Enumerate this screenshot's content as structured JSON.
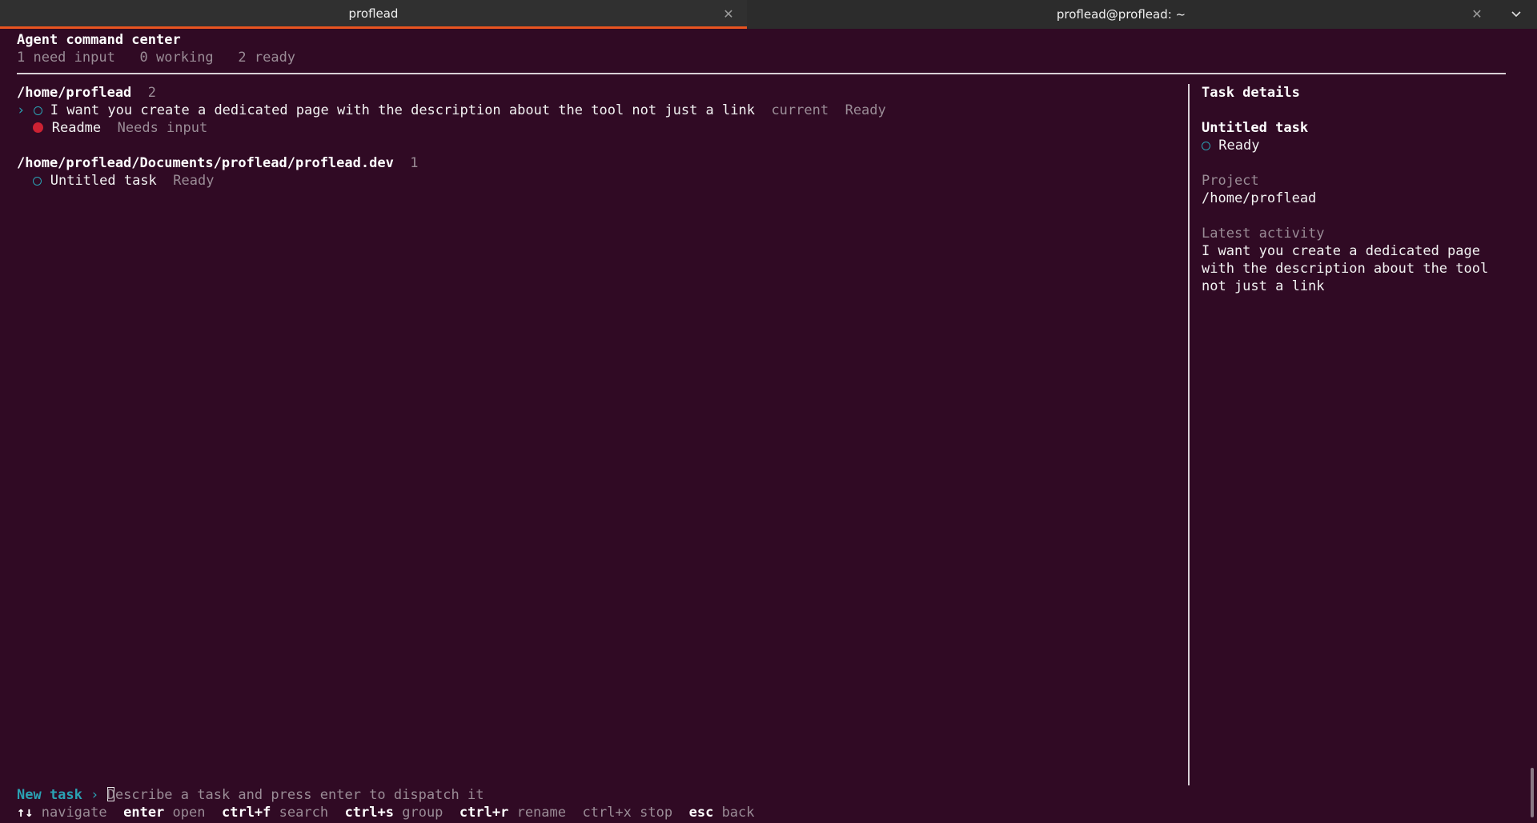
{
  "tabs": [
    {
      "title": "proflead",
      "active": true
    },
    {
      "title": "proflead@proflead: ~",
      "active": false
    }
  ],
  "header": {
    "title": "Agent command center",
    "stats": {
      "need_input": "1 need input",
      "working": "0 working",
      "ready": "2 ready"
    }
  },
  "groups": [
    {
      "path": "/home/proflead",
      "count": "2",
      "tasks": [
        {
          "selector": "›",
          "title": "I want you create a dedicated page with the description about the tool not just a link",
          "tag": "current",
          "status": "Ready",
          "icon": "circle-outline"
        },
        {
          "selector": "",
          "title": "Readme",
          "tag": "",
          "status": "Needs input",
          "icon": "red-dot"
        }
      ]
    },
    {
      "path": "/home/proflead/Documents/proflead/proflead.dev",
      "count": "1",
      "tasks": [
        {
          "selector": "",
          "title": "Untitled task",
          "tag": "",
          "status": "Ready",
          "icon": "circle-outline"
        }
      ]
    }
  ],
  "details": {
    "heading": "Task details",
    "task_title": "Untitled task",
    "status": "Ready",
    "project_label": "Project",
    "project_value": "/home/proflead",
    "activity_label": "Latest activity",
    "activity_lines": [
      "I want you create a dedicated page",
      "with the description about the tool",
      "not just a link"
    ]
  },
  "new_task": {
    "label": "New task",
    "arrow": "›",
    "placeholder": "Describe a task and press enter to dispatch it",
    "placeholder_first": "D",
    "placeholder_rest": "escribe a task and press enter to dispatch it"
  },
  "shortcuts": [
    {
      "key": "↑↓",
      "action": "navigate",
      "key_bold": true
    },
    {
      "key": "enter",
      "action": "open",
      "key_bold": true
    },
    {
      "key": "ctrl+f",
      "action": "search",
      "key_bold": true
    },
    {
      "key": "ctrl+s",
      "action": "group",
      "key_bold": true
    },
    {
      "key": "ctrl+r",
      "action": "rename",
      "key_bold": true
    },
    {
      "key": "ctrl+x",
      "action": "stop",
      "key_bold": false
    },
    {
      "key": "esc",
      "action": "back",
      "key_bold": true
    }
  ],
  "colors": {
    "background": "#300a24",
    "accent": "#e95420",
    "cyan": "#2aa1b3",
    "needs_input_dot": "#cc2233"
  }
}
